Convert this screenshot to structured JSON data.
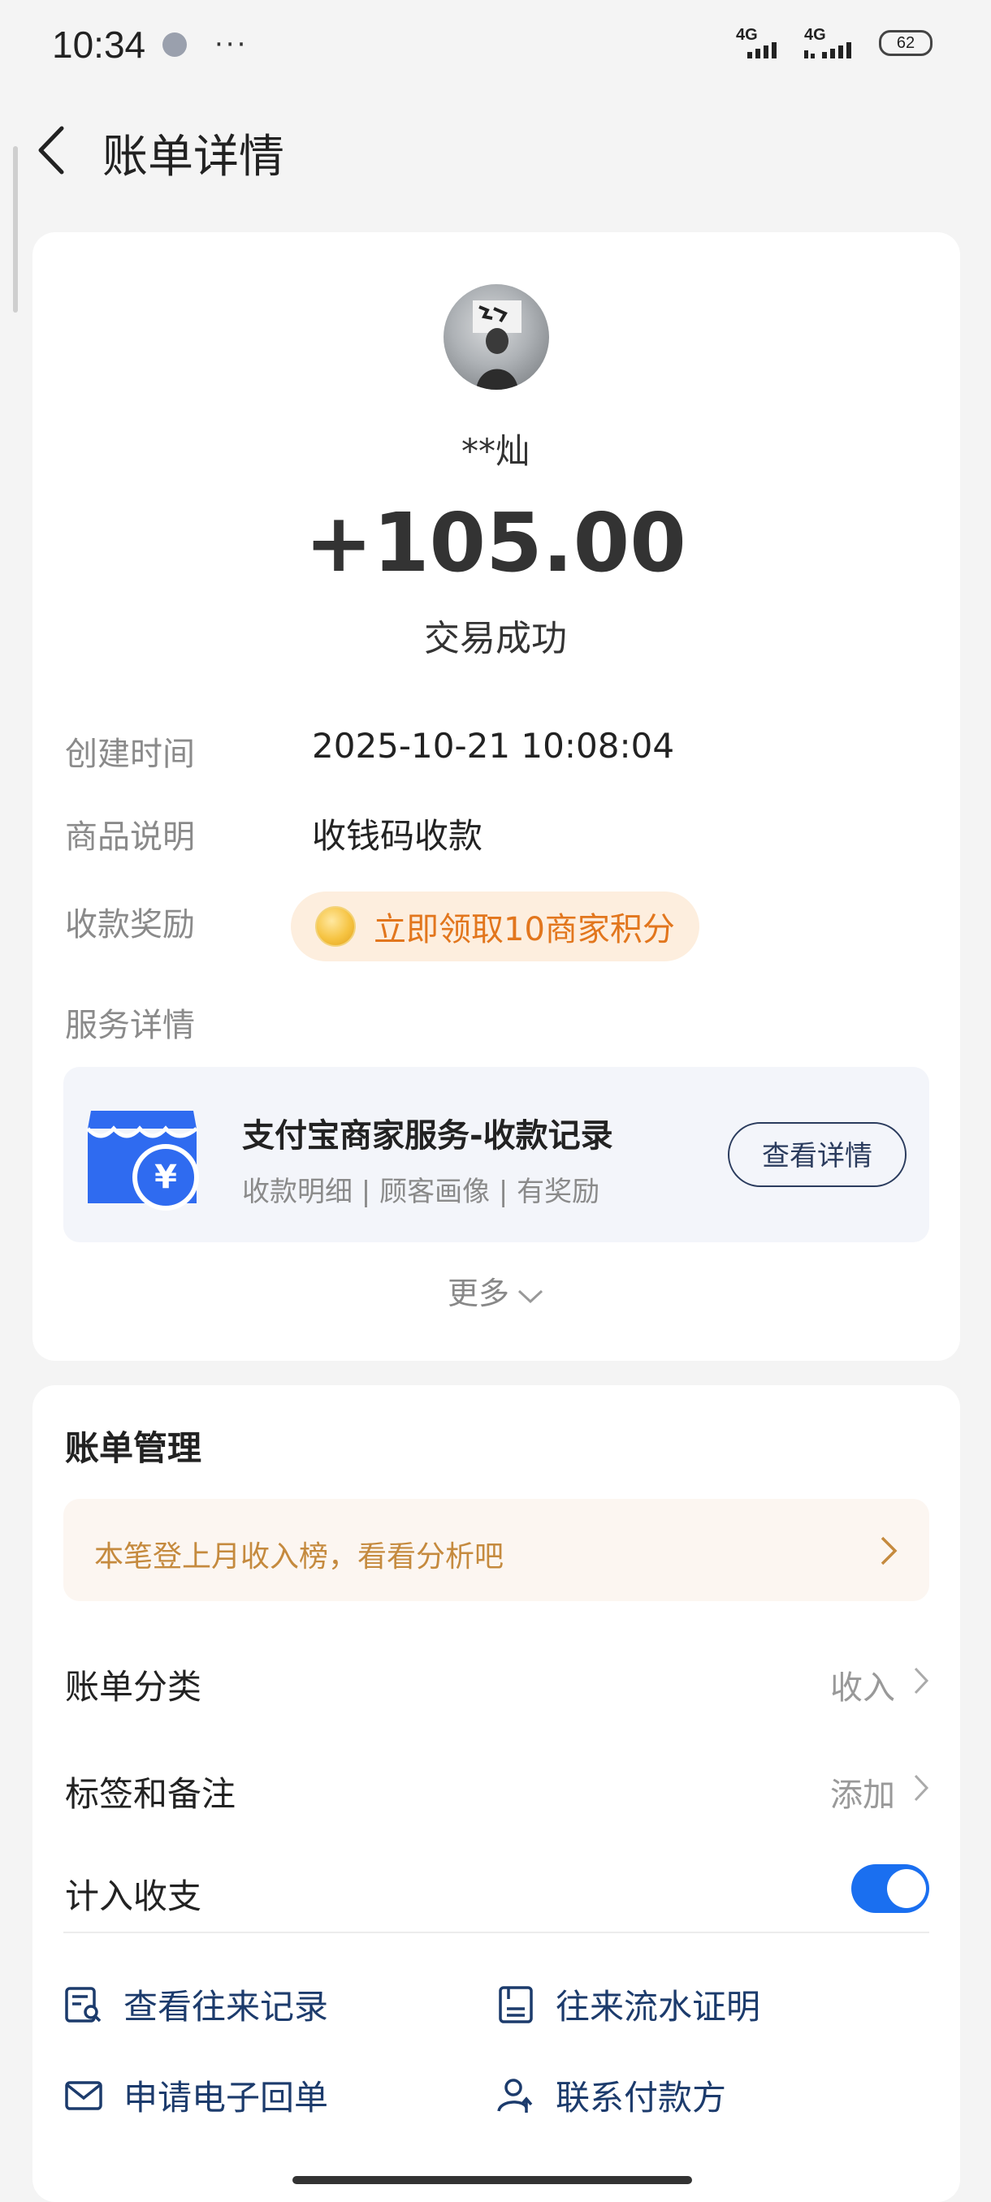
{
  "status_bar": {
    "time": "10:34",
    "more_dots": "···",
    "signal1_label": "4G",
    "signal2_label": "4G",
    "battery": "62"
  },
  "header": {
    "title": "账单详情",
    "back_icon": "chevron-left-icon"
  },
  "transaction": {
    "payer_name": "**灿",
    "amount": "+105.00",
    "status": "交易成功"
  },
  "details": {
    "created_time_label": "创建时间",
    "created_time": "2025-10-21 10:08:04",
    "item_desc_label": "商品说明",
    "item_desc": "收钱码收款",
    "reward_label": "收款奖励",
    "reward_text": "立即领取10商家积分",
    "service_label": "服务详情"
  },
  "service": {
    "title": "支付宝商家服务-收款记录",
    "subtitle": "收款明细 | 顾客画像 | 有奖励",
    "button": "查看详情",
    "icon": "shop-yuan-icon",
    "icon_color": "#2f6bf0"
  },
  "more": "更多",
  "bill_management": {
    "title": "账单管理",
    "banner": "本笔登上月收入榜，看看分析吧",
    "category_label": "账单分类",
    "category_value": "收入",
    "tags_label": "标签和备注",
    "tags_value": "添加",
    "include_label": "计入收支",
    "include_enabled": true,
    "accent_color": "#1a6ff0"
  },
  "actions": {
    "view_records": "查看往来记录",
    "flow_proof": "往来流水证明",
    "e_receipt": "申请电子回单",
    "contact_payer": "联系付款方"
  }
}
